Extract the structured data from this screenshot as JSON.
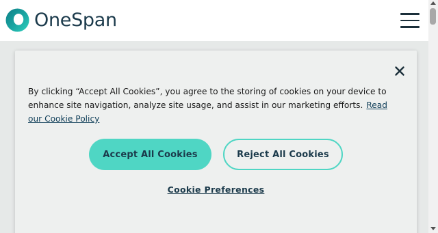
{
  "brand": {
    "name": "OneSpan",
    "accent_color": "#4fd6c4",
    "text_color": "#1b3a4b"
  },
  "header": {
    "logo_icon": "onespan-ring-icon",
    "menu_icon": "hamburger-menu-icon"
  },
  "cookie_banner": {
    "close_icon": "close-icon",
    "message": "By clicking “Accept All Cookies”, you agree to the storing of cookies on your device to enhance site navigation, analyze site usage, and assist in our marketing efforts.",
    "policy_link_label": "Read our Cookie Policy",
    "accept_label": "Accept All Cookies",
    "reject_label": "Reject All Cookies",
    "preferences_label": "Cookie Preferences"
  }
}
